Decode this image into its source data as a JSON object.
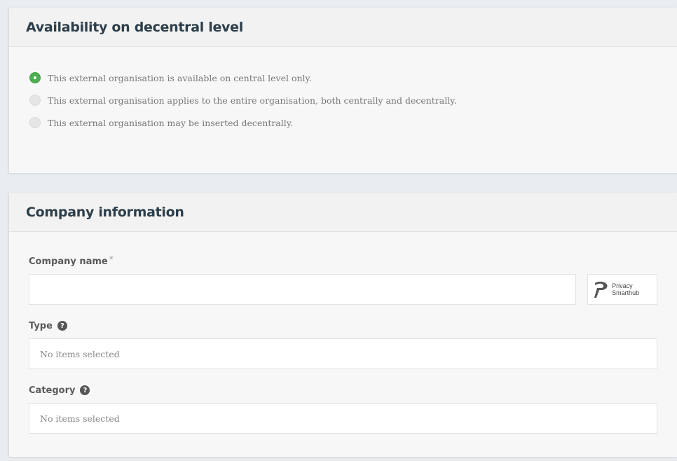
{
  "availability": {
    "title": "Availability on decentral level",
    "options": [
      {
        "label": "This external organisation is available on central level only.",
        "selected": true
      },
      {
        "label": "This external organisation applies to the entire organisation, both centrally and decentrally.",
        "selected": false
      },
      {
        "label": "This external organisation may be inserted decentrally.",
        "selected": false
      }
    ],
    "accent_color": "#4caf50"
  },
  "company": {
    "title": "Company information",
    "company_name": {
      "label": "Company name",
      "required_mark": "*",
      "value": ""
    },
    "smarthub": {
      "line1": "Privacy",
      "line2": "Smarthub",
      "icon": "privacy-smarthub-logo"
    },
    "type": {
      "label": "Type",
      "help_icon": "question-circle-icon",
      "help_glyph": "?",
      "placeholder": "No items selected"
    },
    "category": {
      "label": "Category",
      "help_icon": "question-circle-icon",
      "help_glyph": "?",
      "placeholder": "No items selected"
    }
  }
}
